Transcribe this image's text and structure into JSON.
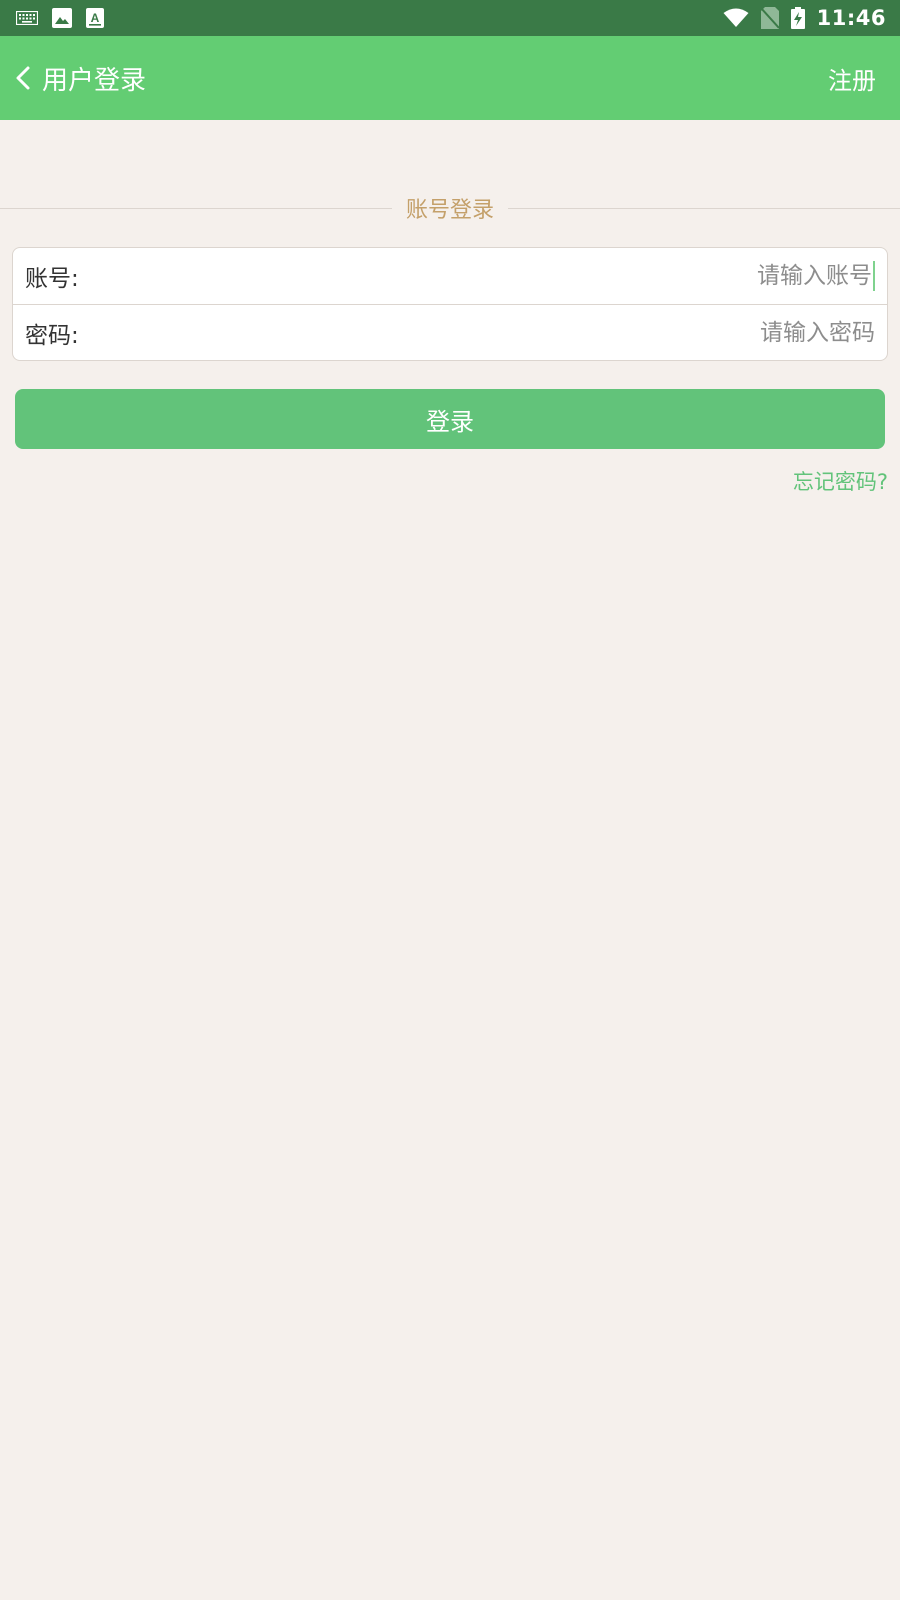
{
  "status_bar": {
    "time": "11:46",
    "left_icons": [
      "keyboard-icon",
      "image-icon",
      "a-notification-icon"
    ],
    "right_icons": [
      "wifi-icon",
      "no-sim-icon",
      "battery-charging-icon"
    ]
  },
  "header": {
    "back_icon": "chevron-left-icon",
    "title": "用户登录",
    "register_label": "注册"
  },
  "section": {
    "title": "账号登录"
  },
  "form": {
    "account": {
      "label": "账号:",
      "value": "",
      "placeholder": "请输入账号"
    },
    "password": {
      "label": "密码:",
      "value": "",
      "placeholder": "请输入密码"
    }
  },
  "login_button": {
    "label": "登录"
  },
  "forgot_password": {
    "label": "忘记密码?"
  },
  "colors": {
    "status_bar": "#3a7a47",
    "header": "#63cd73",
    "background": "#f5f0ec",
    "section_title": "#c4a06a",
    "button": "#62c37a",
    "link": "#62c37a"
  }
}
